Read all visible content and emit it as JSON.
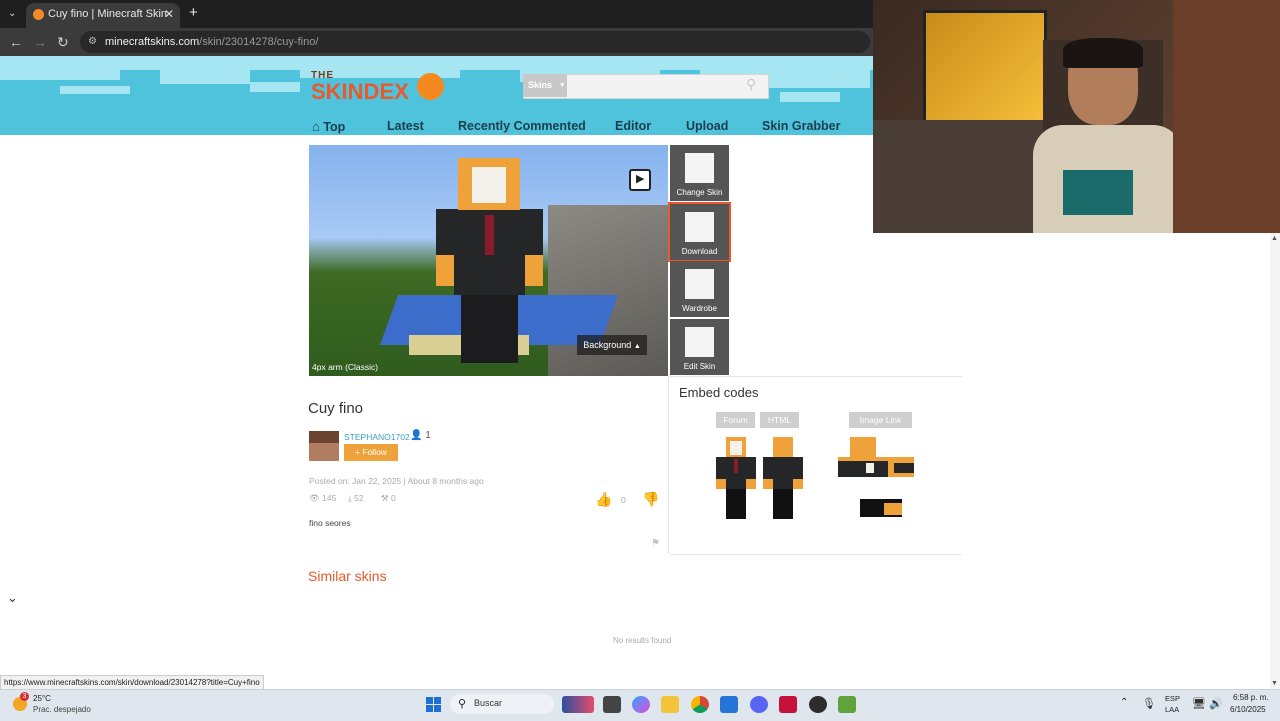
{
  "browser": {
    "tab_title": "Cuy fino | Minecraft Skin",
    "tab_close": "✕",
    "new_tab": "+",
    "url_host": "minecraftskins.com",
    "url_path": "/skin/23014278/cuy-fino/",
    "status_url": "https://www.minecraftskins.com/skin/download/23014278?title=Cuy+fino"
  },
  "header": {
    "logo_the": "THE",
    "logo_name": "SKINDEX",
    "search_category": "Skins",
    "search_placeholder": ""
  },
  "nav": {
    "items": [
      "Top",
      "Latest",
      "Recently Commented",
      "Editor",
      "Upload",
      "Skin Grabber"
    ]
  },
  "viewer": {
    "background_button": "Background",
    "arm_label": "4px arm (Classic)"
  },
  "side_actions": {
    "change_skin": "Change Skin",
    "download": "Download",
    "wardrobe": "Wardrobe",
    "edit_skin": "Edit Skin"
  },
  "skin": {
    "title": "Cuy fino",
    "author": "STEPHANO1702",
    "followers": "1",
    "follow_button": "+ Follow",
    "posted": "Posted on: Jan 22, 2025",
    "ago": "About 8 months ago",
    "views": "145",
    "downloads": "52",
    "favorites": "0",
    "likes": "0",
    "description": "fino seores"
  },
  "embed": {
    "heading": "Embed codes",
    "forum": "Forum",
    "html": "HTML",
    "image_link": "Image Link"
  },
  "similar": {
    "heading": "Similar skins",
    "empty": "No results found"
  },
  "taskbar": {
    "weather_temp": "25°C",
    "weather_desc": "Prac. despejado",
    "search": "Buscar",
    "lang1": "ESP",
    "lang2": "LAA",
    "time": "6:58 p. m.",
    "date": "6/10/2025",
    "badge": "3"
  },
  "colors": {
    "accent": "#e8592b",
    "follow": "#f0a23a",
    "header_sky": "#4fc3dc"
  }
}
